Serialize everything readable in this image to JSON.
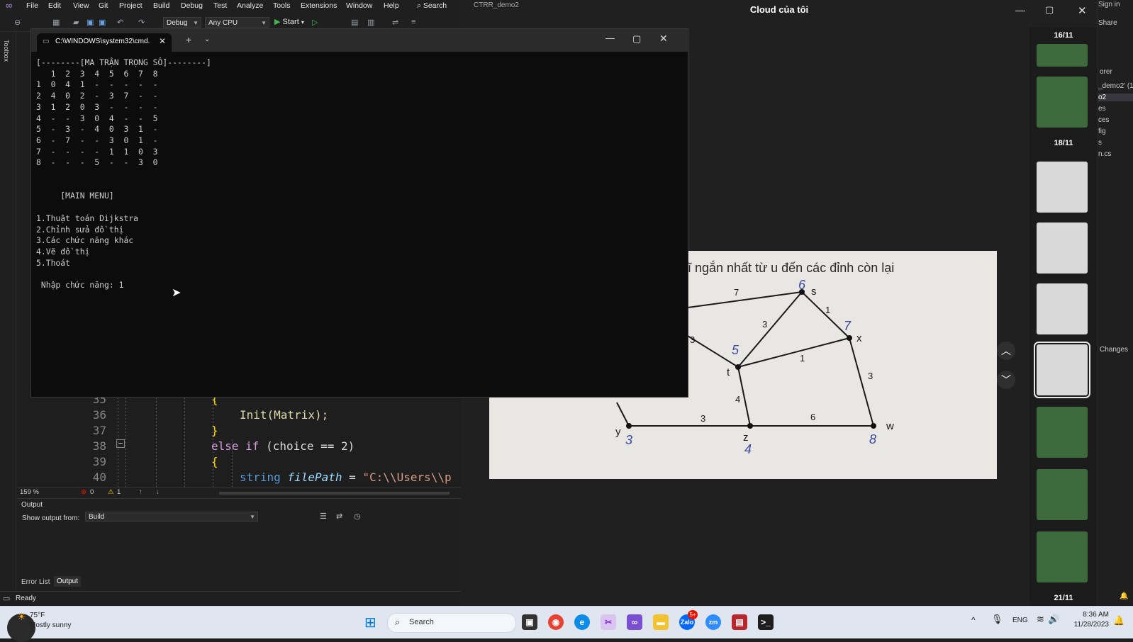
{
  "vs": {
    "menu": [
      "File",
      "Edit",
      "View",
      "Git",
      "Project",
      "Build",
      "Debug",
      "Test",
      "Analyze",
      "Tools",
      "Extensions",
      "Window",
      "Help"
    ],
    "search_label": "Search",
    "project_label": "CTRR_demo2",
    "sign_in": "Sign in",
    "share_label": "Share",
    "toolbar": {
      "config": "Debug",
      "platform": "Any CPU",
      "start": "Start"
    },
    "toolbox_label": "Toolbox",
    "solution_items": [
      "orer",
      "_demo2' (1",
      "o2",
      "es",
      "ces",
      "fig",
      "s",
      "n.cs"
    ],
    "changes_label": "Changes",
    "editor": {
      "lines": [
        {
          "n": "35",
          "text": "{"
        },
        {
          "n": "36",
          "text": "Init(Matrix);"
        },
        {
          "n": "37",
          "text": "}"
        },
        {
          "n": "38",
          "kw1": "else",
          "kw2": "if",
          "rest": " (choice == 2)"
        },
        {
          "n": "39",
          "text": "{"
        },
        {
          "n": "40",
          "kw": "string",
          "var": "filePath",
          "op": " = ",
          "str": "\"C:\\\\Users\\\\p"
        }
      ]
    },
    "status": {
      "zoom": "159 %",
      "errors": "0",
      "warnings": "1"
    },
    "output": {
      "title": "Output",
      "show_from_label": "Show output from:",
      "source": "Build",
      "tabs": [
        "Error List",
        "Output"
      ]
    },
    "statusbar": {
      "text": "Ready"
    }
  },
  "console": {
    "tab_title": "C:\\WINDOWS\\system32\\cmd.",
    "lines": [
      "[--------[MA TRẬN TRỌNG SỐ]--------]",
      "   1  2  3  4  5  6  7  8",
      "1  0  4  1  -  -  -  -  -",
      "2  4  0  2  -  3  7  -  -",
      "3  1  2  0  3  -  -  -  -",
      "4  -  -  3  0  4  -  -  5",
      "5  -  3  -  4  0  3  1  -",
      "6  -  7  -  -  3  0  1  -",
      "7  -  -  -  -  1  1  0  3",
      "8  -  -  -  5  -  -  3  0",
      "",
      "",
      "     [MAIN MENU]",
      "",
      "1.Thuật toán Dijkstra",
      "2.Chỉnh sửa đồ thị",
      "3.Các chức năng khác",
      "4.Vẽ đồ thị",
      "5.Thoát",
      "",
      " Nhập chức năng: 1"
    ]
  },
  "viewer": {
    "title": "Cloud của tôi",
    "dates": [
      "16/11",
      "18/11",
      "21/11"
    ],
    "photo": {
      "heading": "ĩ ngắn nhất từ u đến các đỉnh còn lại",
      "nodes": [
        "s",
        "x",
        "t",
        "y",
        "z",
        "w"
      ],
      "edge_labels": [
        "7",
        "3",
        "1",
        "1",
        "3",
        "3",
        "4",
        "3",
        "6"
      ],
      "handwritten": [
        "6",
        "7",
        "5",
        "3",
        "4",
        "8"
      ]
    }
  },
  "taskbar": {
    "weather_temp": "75°F",
    "weather_desc": "Mostly sunny",
    "search_placeholder": "Search",
    "lang": "ENG",
    "time": "8:36 AM",
    "date": "11/28/2023",
    "zalo_badge": "5+"
  }
}
